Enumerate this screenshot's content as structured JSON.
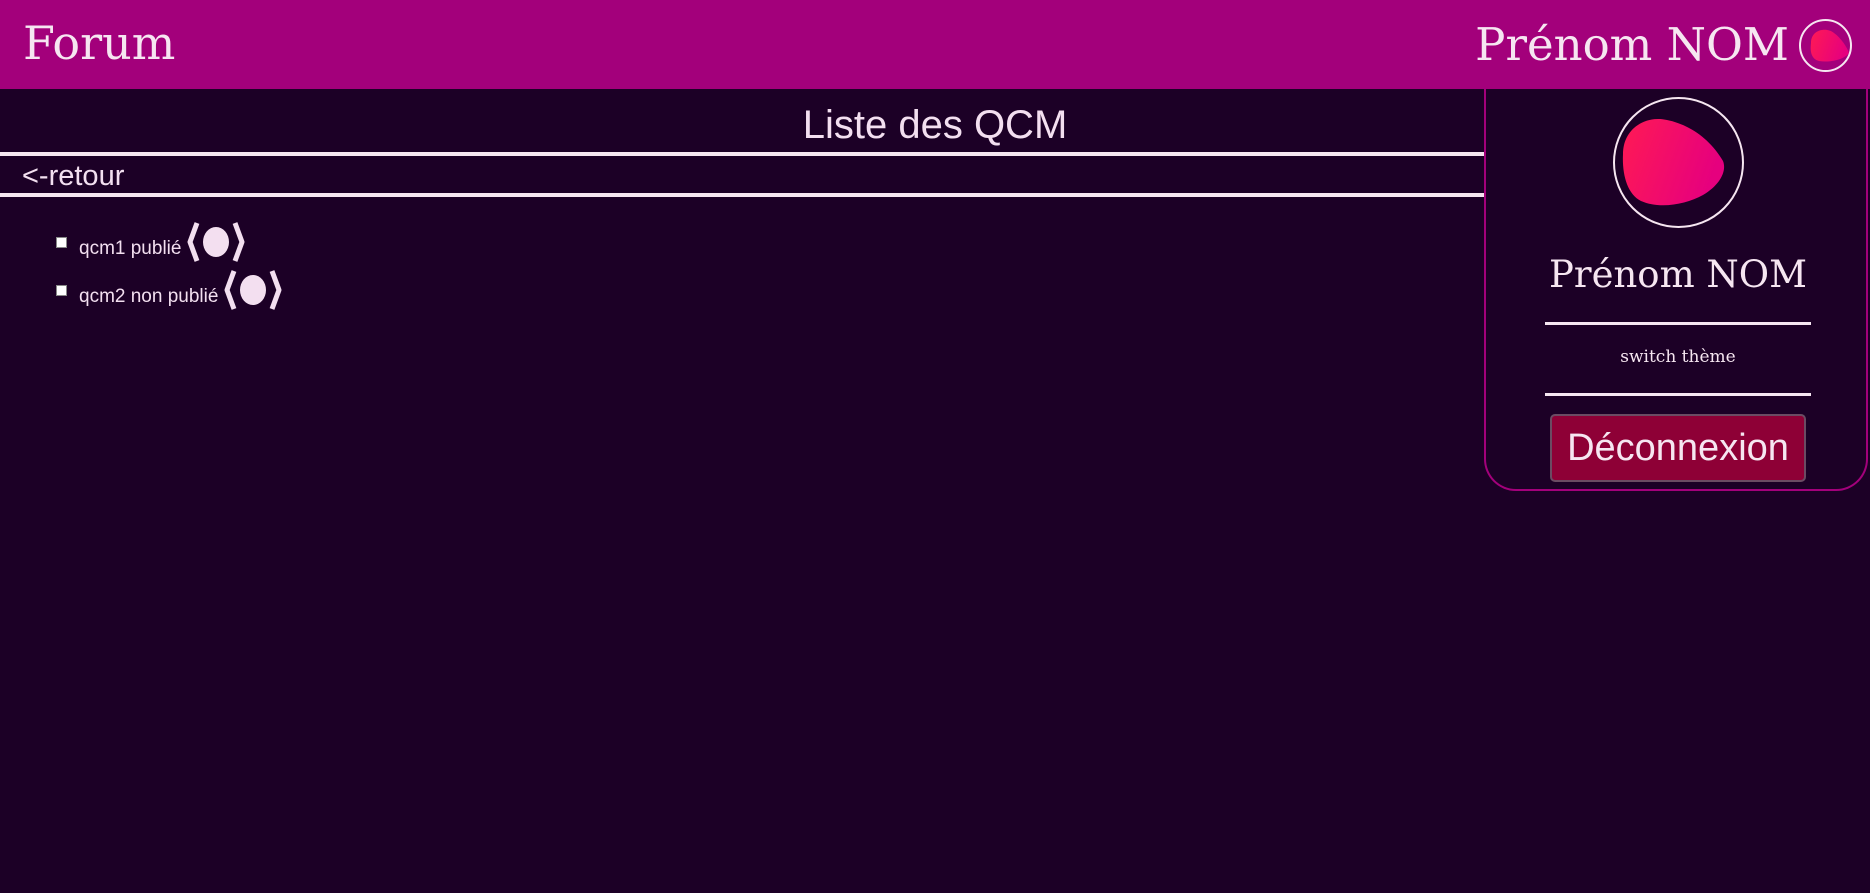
{
  "header": {
    "brand": "Forum",
    "username": "Prénom NOM"
  },
  "main": {
    "title": "Liste des QCM",
    "back_label": "<-retour",
    "qcms": [
      {
        "label": "qcm1 publié",
        "icon": "preview-icon"
      },
      {
        "label": "qcm2 non publié",
        "icon": "preview-icon"
      }
    ]
  },
  "user_panel": {
    "name": "Prénom NOM",
    "theme_switch_label": "switch thème",
    "logout_label": "Déconnexion"
  },
  "colors": {
    "background": "#1c0026",
    "header": "#a3007b",
    "accent_gradient_start": "#ff1a54",
    "accent_gradient_end": "#e6007e",
    "logout_button": "#8e0036",
    "text": "#f3dff0"
  }
}
